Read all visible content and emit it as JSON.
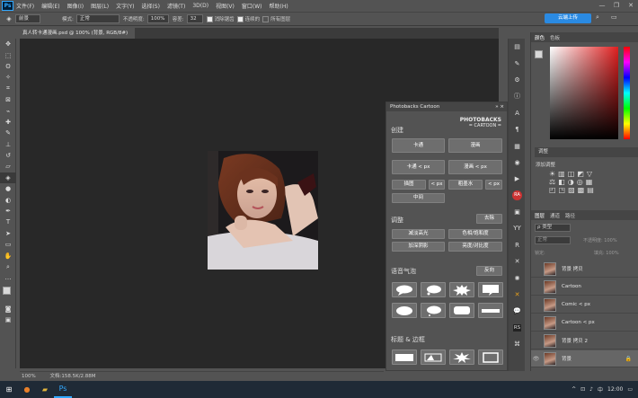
{
  "app": {
    "logo": "Ps"
  },
  "menu": [
    "文件(F)",
    "编辑(E)",
    "图像(I)",
    "图层(L)",
    "文字(Y)",
    "选择(S)",
    "滤镜(T)",
    "3D(D)",
    "视图(V)",
    "窗口(W)",
    "帮助(H)"
  ],
  "window_controls": [
    "—",
    "❐",
    "✕"
  ],
  "options": {
    "preset": "前景",
    "mode_label": "模式:",
    "mode_value": "正常",
    "opacity_label": "不透明度:",
    "opacity_value": "100%",
    "tolerance_label": "容差:",
    "tolerance_value": "32",
    "antialias": "消除锯齿",
    "contiguous": "连续的",
    "all_layers": "所有图层",
    "cloud_button": "云端上传"
  },
  "document": {
    "tab_title": "真人转卡通漫画.psd @ 100% (背景, RGB/8#)",
    "close": "×"
  },
  "status": {
    "zoom": "100%",
    "doc_size": "文档:158.5K/2.88M"
  },
  "cartoon_panel": {
    "title": "Photobacks Cartoon",
    "brand_line1": "PHOTOBACKS",
    "brand_line2": "= CARTOON =",
    "create_title": "创建",
    "btn_cartoon": "卡通",
    "btn_comic": "漫画",
    "btn_cartoon_px": "卡通 < px",
    "btn_comic_px": "漫画 < px",
    "btn_shadow": "描图",
    "btn_lt_px": "< px",
    "btn_watercolor": "粗墨水",
    "btn_lt_px2": "< px",
    "btn_medium": "中间",
    "adjust_title": "调整",
    "btn_remove": "去除",
    "btn_dodge": "减淡高光",
    "btn_hue": "色相/饱和度",
    "btn_burn": "加深阴影",
    "btn_brightness": "亮度/对比度",
    "bubbles_title": "语音气泡",
    "btn_reverse": "反向",
    "borders_title": "标题 & 边框"
  },
  "color_panel": {
    "tabs": [
      "颜色",
      "色板"
    ]
  },
  "adjust_panel": {
    "title": "调整",
    "subtitle": "添加调整"
  },
  "layers_panel": {
    "tabs": [
      "图层",
      "通道",
      "路径"
    ],
    "filter": "ρ 类型",
    "blend": "正常",
    "opacity": "不透明度: 100%",
    "lock": "锁定:",
    "fill": "填充: 100%",
    "layers": [
      "背景 拷贝",
      "Cartoon",
      "Comic < px",
      "Cartoon < px",
      "背景 拷贝 2",
      "背景"
    ]
  },
  "taskbar": {
    "ime": "中",
    "time": "12:00"
  },
  "colors": {
    "accent": "#2a8ae2",
    "bg_dark": "#282828",
    "panel": "#535353",
    "taskbar": "#1f2a36"
  }
}
